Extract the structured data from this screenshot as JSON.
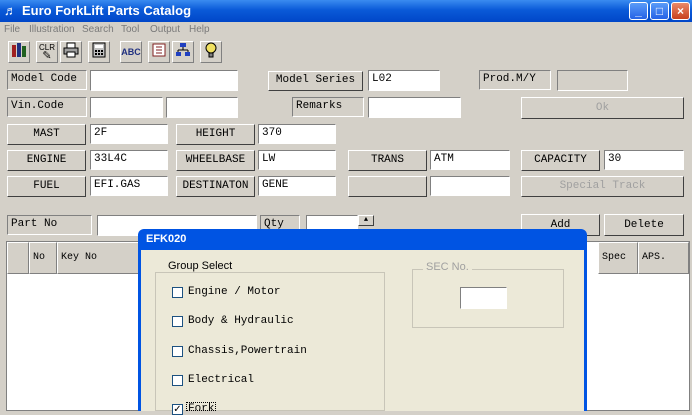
{
  "window": {
    "title": "Euro ForkLift Parts Catalog"
  },
  "menu": [
    "File",
    "Illustration",
    "Search",
    "Tool",
    "Output",
    "Help"
  ],
  "toolbar": {
    "clr_label": "CLR",
    "abc_label": "ABC"
  },
  "form": {
    "model_code": {
      "label": "Model Code",
      "value": ""
    },
    "model_series": {
      "label": "Model Series",
      "value": "L02"
    },
    "prod_my": {
      "label": "Prod.M/Y",
      "value": ""
    },
    "vin_code": {
      "label": "Vin.Code",
      "value1": "",
      "value2": ""
    },
    "remarks": {
      "label": "Remarks",
      "value": ""
    },
    "ok_label": "Ok",
    "mast": {
      "label": "MAST",
      "value": "2F"
    },
    "height": {
      "label": "HEIGHT",
      "value": "370"
    },
    "engine": {
      "label": "ENGINE",
      "value": "33L4C"
    },
    "wheelbase": {
      "label": "WHEELBASE",
      "value": "LW"
    },
    "trans": {
      "label": "TRANS",
      "value": "ATM"
    },
    "capacity": {
      "label": "CAPACITY",
      "value": "30"
    },
    "fuel": {
      "label": "FUEL",
      "value": "EFI.GAS"
    },
    "destination": {
      "label": "DESTINATON",
      "value": "GENE"
    },
    "special_track_label": "Special Track",
    "part_no": {
      "label": "Part No",
      "value": ""
    },
    "qty": {
      "label": "Qty",
      "value": ""
    },
    "add_label": "Add",
    "delete_label": "Delete"
  },
  "grid": {
    "columns": [
      "No",
      "Key No",
      "Spec",
      "APS."
    ]
  },
  "dialog": {
    "title": "EFK020",
    "group_caption": "Group Select",
    "sec_caption": "SEC No.",
    "sec_value": "",
    "groups": [
      {
        "label": "Engine / Motor",
        "checked": false
      },
      {
        "label": "Body & Hydraulic",
        "checked": false
      },
      {
        "label": "Chassis,Powertrain",
        "checked": false
      },
      {
        "label": "Electrical",
        "checked": false
      },
      {
        "label": "Fork",
        "checked": true
      }
    ]
  }
}
